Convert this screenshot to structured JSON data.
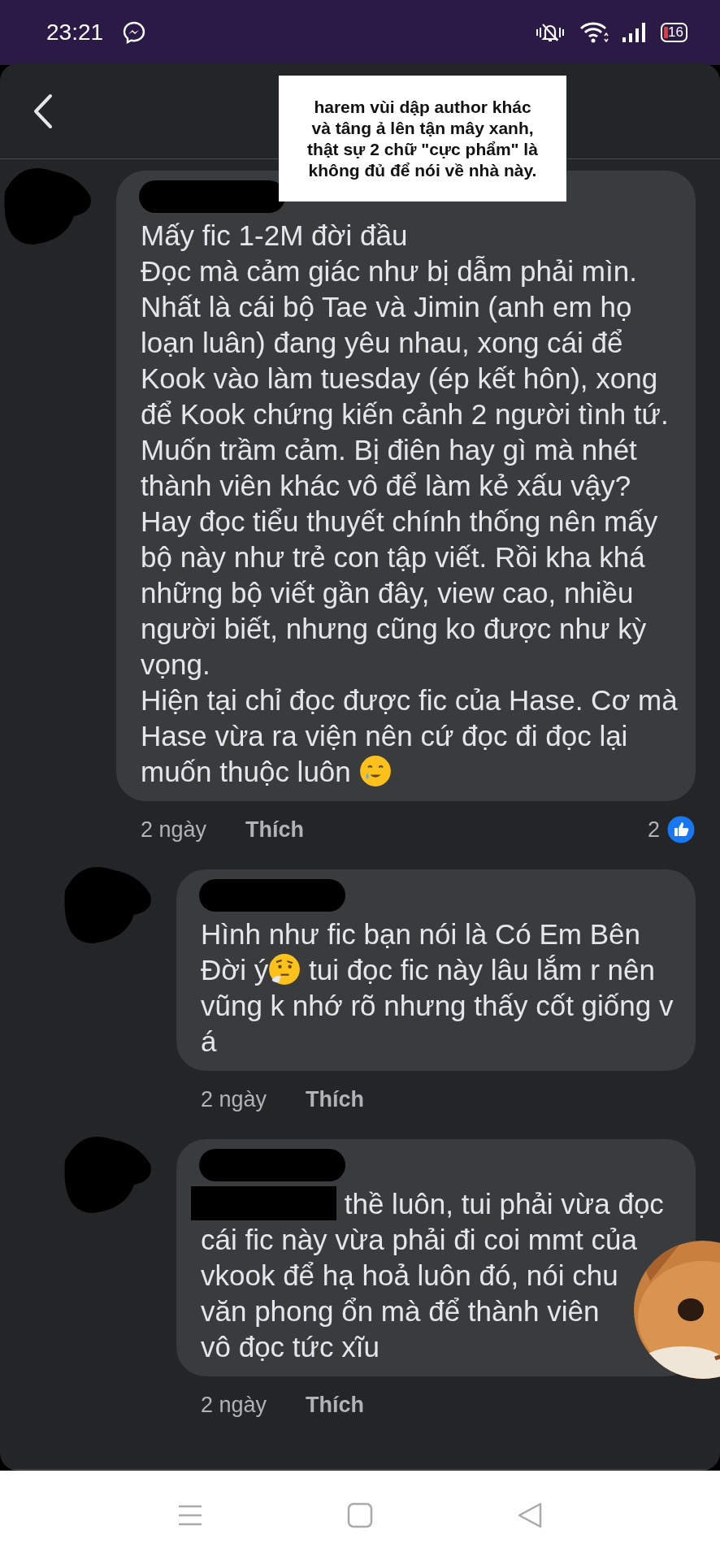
{
  "status_bar": {
    "time": "23:21",
    "battery": "16"
  },
  "caption": "harem vùi dập author khác\nvà tâng ả lên tận mây xanh,\nthật sự 2 chữ \"cực phẩm\" là\nkhông đủ để nói về nhà này.",
  "comments": [
    {
      "reply": false,
      "segments": [
        {
          "kind": "text",
          "text": "Mấy fic 1-2M đời đầu\nĐọc mà cảm giác như bị dẫm phải mìn. Nhất là cái bộ Tae và Jimin (anh em họ loạn luân) đang yêu nhau, xong cái để Kook vào làm tuesday (ép kết hôn), xong để Kook chứng kiến cảnh 2 người tình tứ. Muốn trầm cảm. Bị điên hay gì mà nhét thành viên khác vô để làm kẻ xấu vậy? Hay đọc tiểu thuyết chính thống nên mấy bộ này như trẻ con tập viết. Rồi kha khá những bộ viết gần đây, view cao, nhiều người biết, nhưng cũng ko được như kỳ vọng.\nHiện tại chỉ đọc được fic của Hase. Cơ mà Hase vừa ra viện nên cứ đọc đi đọc lại muốn thuộc luôn "
        },
        {
          "kind": "tear"
        }
      ],
      "time": "2 ngày",
      "like_label": "Thích",
      "reaction_count": "2"
    },
    {
      "reply": true,
      "segments": [
        {
          "kind": "text",
          "text": "Hình như fic bạn nói là Có Em Bên Đời ý"
        },
        {
          "kind": "thinking"
        },
        {
          "kind": "text",
          "text": " tui đọc fic này lâu lắm r nên vũng k nhớ rõ nhưng thấy cốt giống v á"
        }
      ],
      "time": "2 ngày",
      "like_label": "Thích"
    },
    {
      "reply": true,
      "sticker": true,
      "segments": [
        {
          "kind": "redaction"
        },
        {
          "kind": "text",
          "text": " thề luôn, tui phải vừa đọc\ncái fic này vừa phải đi coi mmt của\nvkook để hạ hoả luôn đó, nói chu\nvăn phong ổn mà để thành viên\nvô đọc tức xĩu"
        }
      ],
      "time": "2 ngày",
      "like_label": "Thích"
    }
  ]
}
